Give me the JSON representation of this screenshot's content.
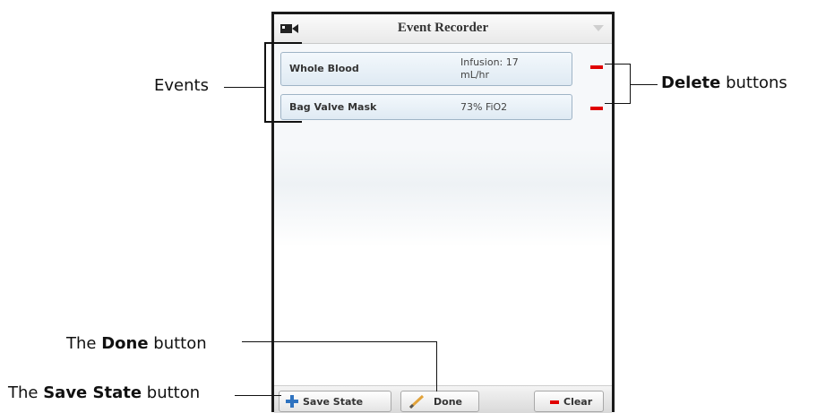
{
  "window": {
    "title": "Event Recorder",
    "icon_left": "camera-icon",
    "icon_right": "dropdown-menu-icon"
  },
  "events": [
    {
      "name": "Whole Blood",
      "value": "Infusion: 17 mL/hr",
      "delete_icon": "minus-icon"
    },
    {
      "name": "Bag Valve Mask",
      "value": "73% FiO2",
      "delete_icon": "minus-icon"
    }
  ],
  "toolbar": {
    "save_state_label": "Save State",
    "done_label": "Done",
    "clear_label": "Clear"
  },
  "annotations": {
    "events": "Events",
    "delete_bold": "Delete",
    "delete_rest": " buttons",
    "done_prefix": "The ",
    "done_bold": "Done",
    "done_rest": " button",
    "save_prefix": "The ",
    "save_bold": "Save State",
    "save_rest": " button"
  },
  "colors": {
    "delete_red": "#e00000",
    "plus_blue": "#2f73c0",
    "row_border": "#9fb4c6"
  }
}
